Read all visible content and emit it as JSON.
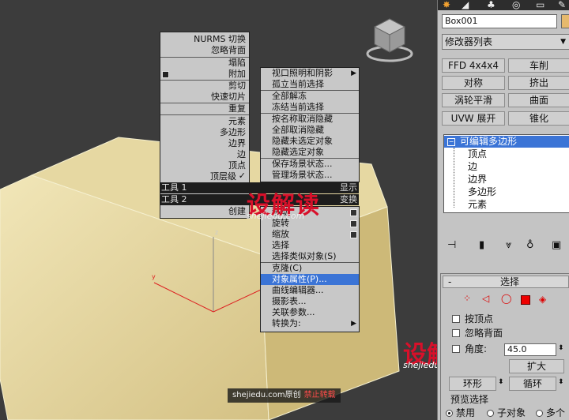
{
  "quad_left": {
    "items": [
      "NURMS 切换",
      "忽略背面",
      "塌陷",
      "附加",
      "剪切",
      "快速切片",
      "重复",
      "元素",
      "多边形",
      "边界",
      "边",
      "顶点",
      "顶层级"
    ],
    "checked_mark": "✓",
    "tools1_label": "工具 1",
    "tools2_label": "工具 2",
    "display_label": "显示",
    "transform_label": "变换",
    "create_label": "创建"
  },
  "quad_top_right": {
    "items": [
      "视口照明和阴影",
      "孤立当前选择",
      "全部解冻",
      "冻结当前选择",
      "按名称取消隐藏",
      "全部取消隐藏",
      "隐藏未选定对象",
      "隐藏选定对象",
      "保存场景状态...",
      "管理场景状态..."
    ]
  },
  "quad_bottom_right": {
    "items": [
      "移动",
      "旋转",
      "缩放",
      "选择",
      "选择类似对象(S)",
      "克隆(C)",
      "对象属性(P)...",
      "曲线编辑器...",
      "摄影表...",
      "关联参数...",
      "转换为:"
    ],
    "highlighted": "对象属性(P)..."
  },
  "axis": {
    "y": "y",
    "z": "z"
  },
  "watermark": {
    "brand": "设解读",
    "url": "shejiedu.com"
  },
  "credit": {
    "site": "shejiedu.com原创",
    "notice": "禁止转载"
  },
  "panel": {
    "object_name": "Box001",
    "object_color": "#e6b96d",
    "modifier_list": "修改器列表",
    "modifier_buttons": [
      "FFD 4x4x4",
      "车削",
      "对称",
      "挤出",
      "涡轮平滑",
      "曲面",
      "UVW 展开",
      "锥化"
    ],
    "stack_root": "可编辑多边形",
    "stack_items": [
      "顶点",
      "边",
      "边界",
      "多边形",
      "元素"
    ],
    "selection_title": "选择",
    "by_vertex": "按顶点",
    "ignore_backfacing": "忽略背面",
    "angle_label": "角度:",
    "angle_value": "45.0",
    "grow": "扩大",
    "ring": "环形",
    "loop": "循环",
    "preview_label": "预览选择",
    "preview_options": [
      "禁用",
      "子对象",
      "多个"
    ]
  },
  "colors": {
    "accent": "#3b74d6",
    "box_face": "#e7d8a4",
    "watermark": "#d8102a"
  }
}
